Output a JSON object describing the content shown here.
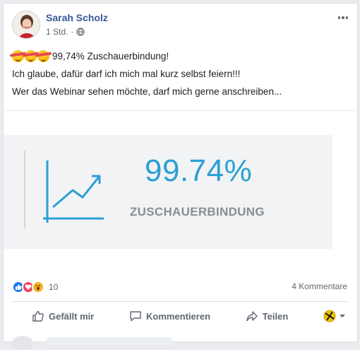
{
  "post": {
    "author": "Sarah Scholz",
    "time": "1 Std.",
    "privacy_icon": "globe-icon",
    "menu_icon": "more-horizontal-icon",
    "lines": [
      "99,74% Zuschauerbindung!",
      "Ich glaube, dafür darf ich mich mal kurz selbst feiern!!!",
      "Wer das Webinar sehen möchte, darf mich gerne anschreiben..."
    ],
    "emoji_icon": "partying-face-icon"
  },
  "link_image": {
    "number": "99.74%",
    "label": "ZUSCHAUERBINDUNG",
    "chart_icon": "trend-up-chart-icon",
    "accent": "#2b9fd4"
  },
  "reactions": {
    "count": "10",
    "types": [
      "like",
      "love",
      "wow"
    ],
    "comments": "4 Kommentare"
  },
  "actions": {
    "like": "Gefällt mir",
    "comment": "Kommentieren",
    "share": "Teilen"
  },
  "colors": {
    "link_blue": "#385898",
    "muted": "#606770",
    "like_blue": "#1877f2",
    "love_red": "#f33e58",
    "wow_yellow": "#f7b125"
  }
}
